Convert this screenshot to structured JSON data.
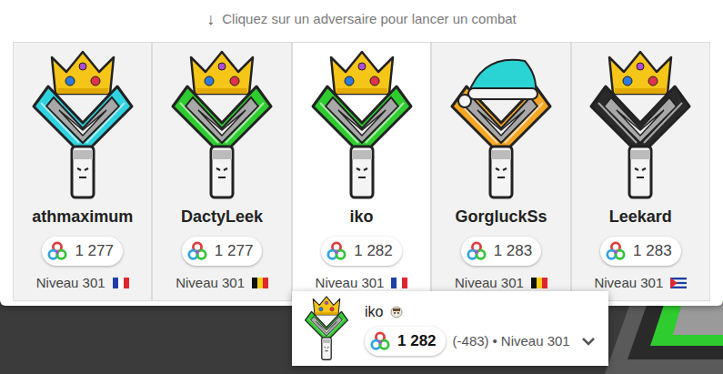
{
  "header": {
    "arrow": "↓",
    "text": "Cliquez sur un adversaire pour lancer un combat"
  },
  "opponents": [
    {
      "name": "athmaximum",
      "talent": "1 277",
      "level": "Niveau 301",
      "country": "fr",
      "color": "#2fd3e0",
      "headwear": "crown",
      "selected": false
    },
    {
      "name": "DactyLeek",
      "talent": "1 277",
      "level": "Niveau 301",
      "country": "be",
      "color": "#2ecc2e",
      "headwear": "crown",
      "selected": false
    },
    {
      "name": "iko",
      "talent": "1 282",
      "level": "Niveau 301",
      "country": "fr",
      "color": "#2ecc2e",
      "headwear": "crown",
      "selected": true
    },
    {
      "name": "GorgluckSs",
      "talent": "1 283",
      "level": "Niveau 301",
      "country": "be",
      "color": "#f5a623",
      "headwear": "hat",
      "selected": false
    },
    {
      "name": "Leekard",
      "talent": "1 283",
      "level": "Niveau 301",
      "country": "cu",
      "color": "#2a2a2a",
      "headwear": "crown",
      "selected": false
    }
  ],
  "farmer": {
    "name": "iko",
    "talent": "1 282",
    "delta": "(-483)",
    "separator": "•",
    "level": "Niveau 301",
    "color": "#2ecc2e",
    "expanded": false
  }
}
